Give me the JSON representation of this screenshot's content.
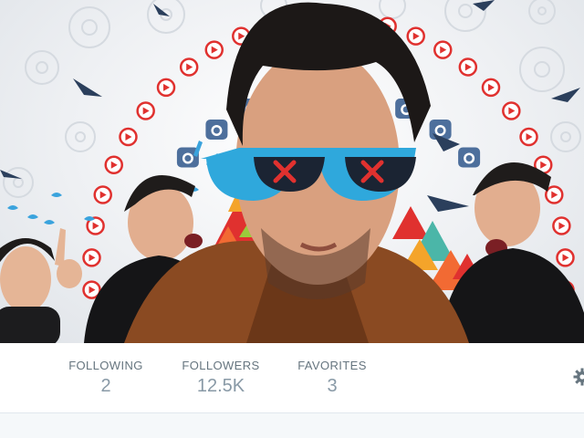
{
  "profile": {
    "stats": [
      {
        "label": "FOLLOWING",
        "value": "2"
      },
      {
        "label": "FOLLOWERS",
        "value": "12.5K"
      },
      {
        "label": "FAVORITES",
        "value": "3"
      }
    ]
  },
  "icons": {
    "settings": "gear-icon"
  },
  "colors": {
    "accent_red": "#e0312f",
    "glasses_blue": "#2fa8dc",
    "jacket_brown": "#8a4a22",
    "stat_value": "#8899a6",
    "stat_label": "#66757f"
  }
}
